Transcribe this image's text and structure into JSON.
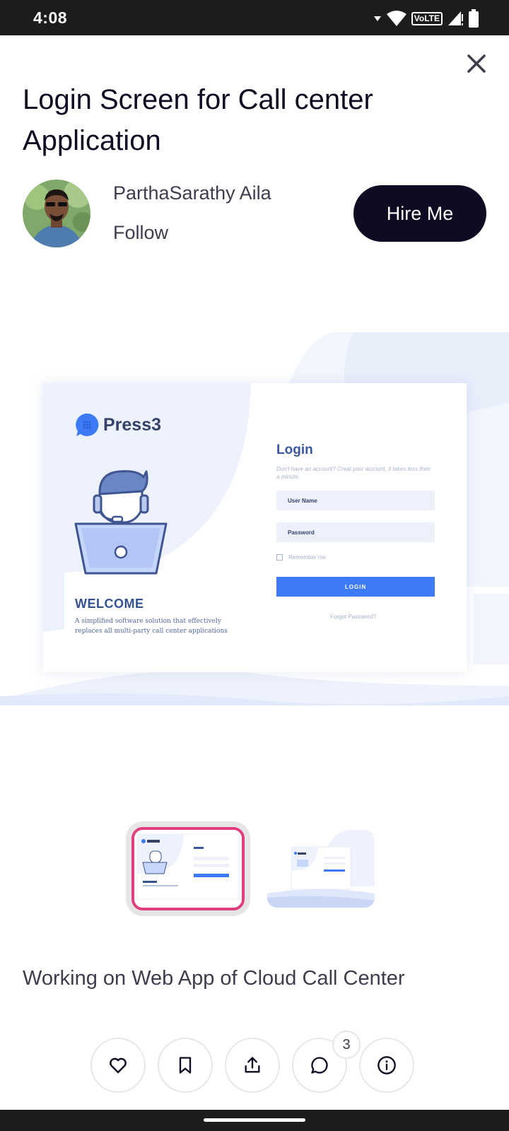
{
  "status_bar": {
    "time": "4:08",
    "network_label": "VoLTE",
    "icons": [
      "wifi-icon",
      "signal-icon",
      "battery-icon"
    ]
  },
  "shot": {
    "title": "Login Screen for Call center Application",
    "designer_name": "ParthaSarathy Aila",
    "follow_label": "Follow",
    "hire_label": "Hire Me",
    "description": "Working on Web App of Cloud Call Center"
  },
  "mockup": {
    "brand": "Press3",
    "welcome_title": "WELCOME",
    "welcome_desc": "A simplified software solution that effectively replaces all multi-party call center applications",
    "login_title": "Login",
    "login_subtitle": "Don't have an account? Creat your account, it takes less then a minute.",
    "username_placeholder": "User Name",
    "password_placeholder": "Password",
    "remember_label": "Remember me",
    "login_button": "LOGIN",
    "forgot_label": "Forgot Password?"
  },
  "actions": {
    "comment_count": "3",
    "icons": [
      "heart-icon",
      "bookmark-icon",
      "share-icon",
      "comment-icon",
      "info-icon"
    ]
  },
  "colors": {
    "primary_dark": "#0d0c22",
    "accent_pink": "#e03e7e",
    "mock_blue": "#3d7af6"
  }
}
